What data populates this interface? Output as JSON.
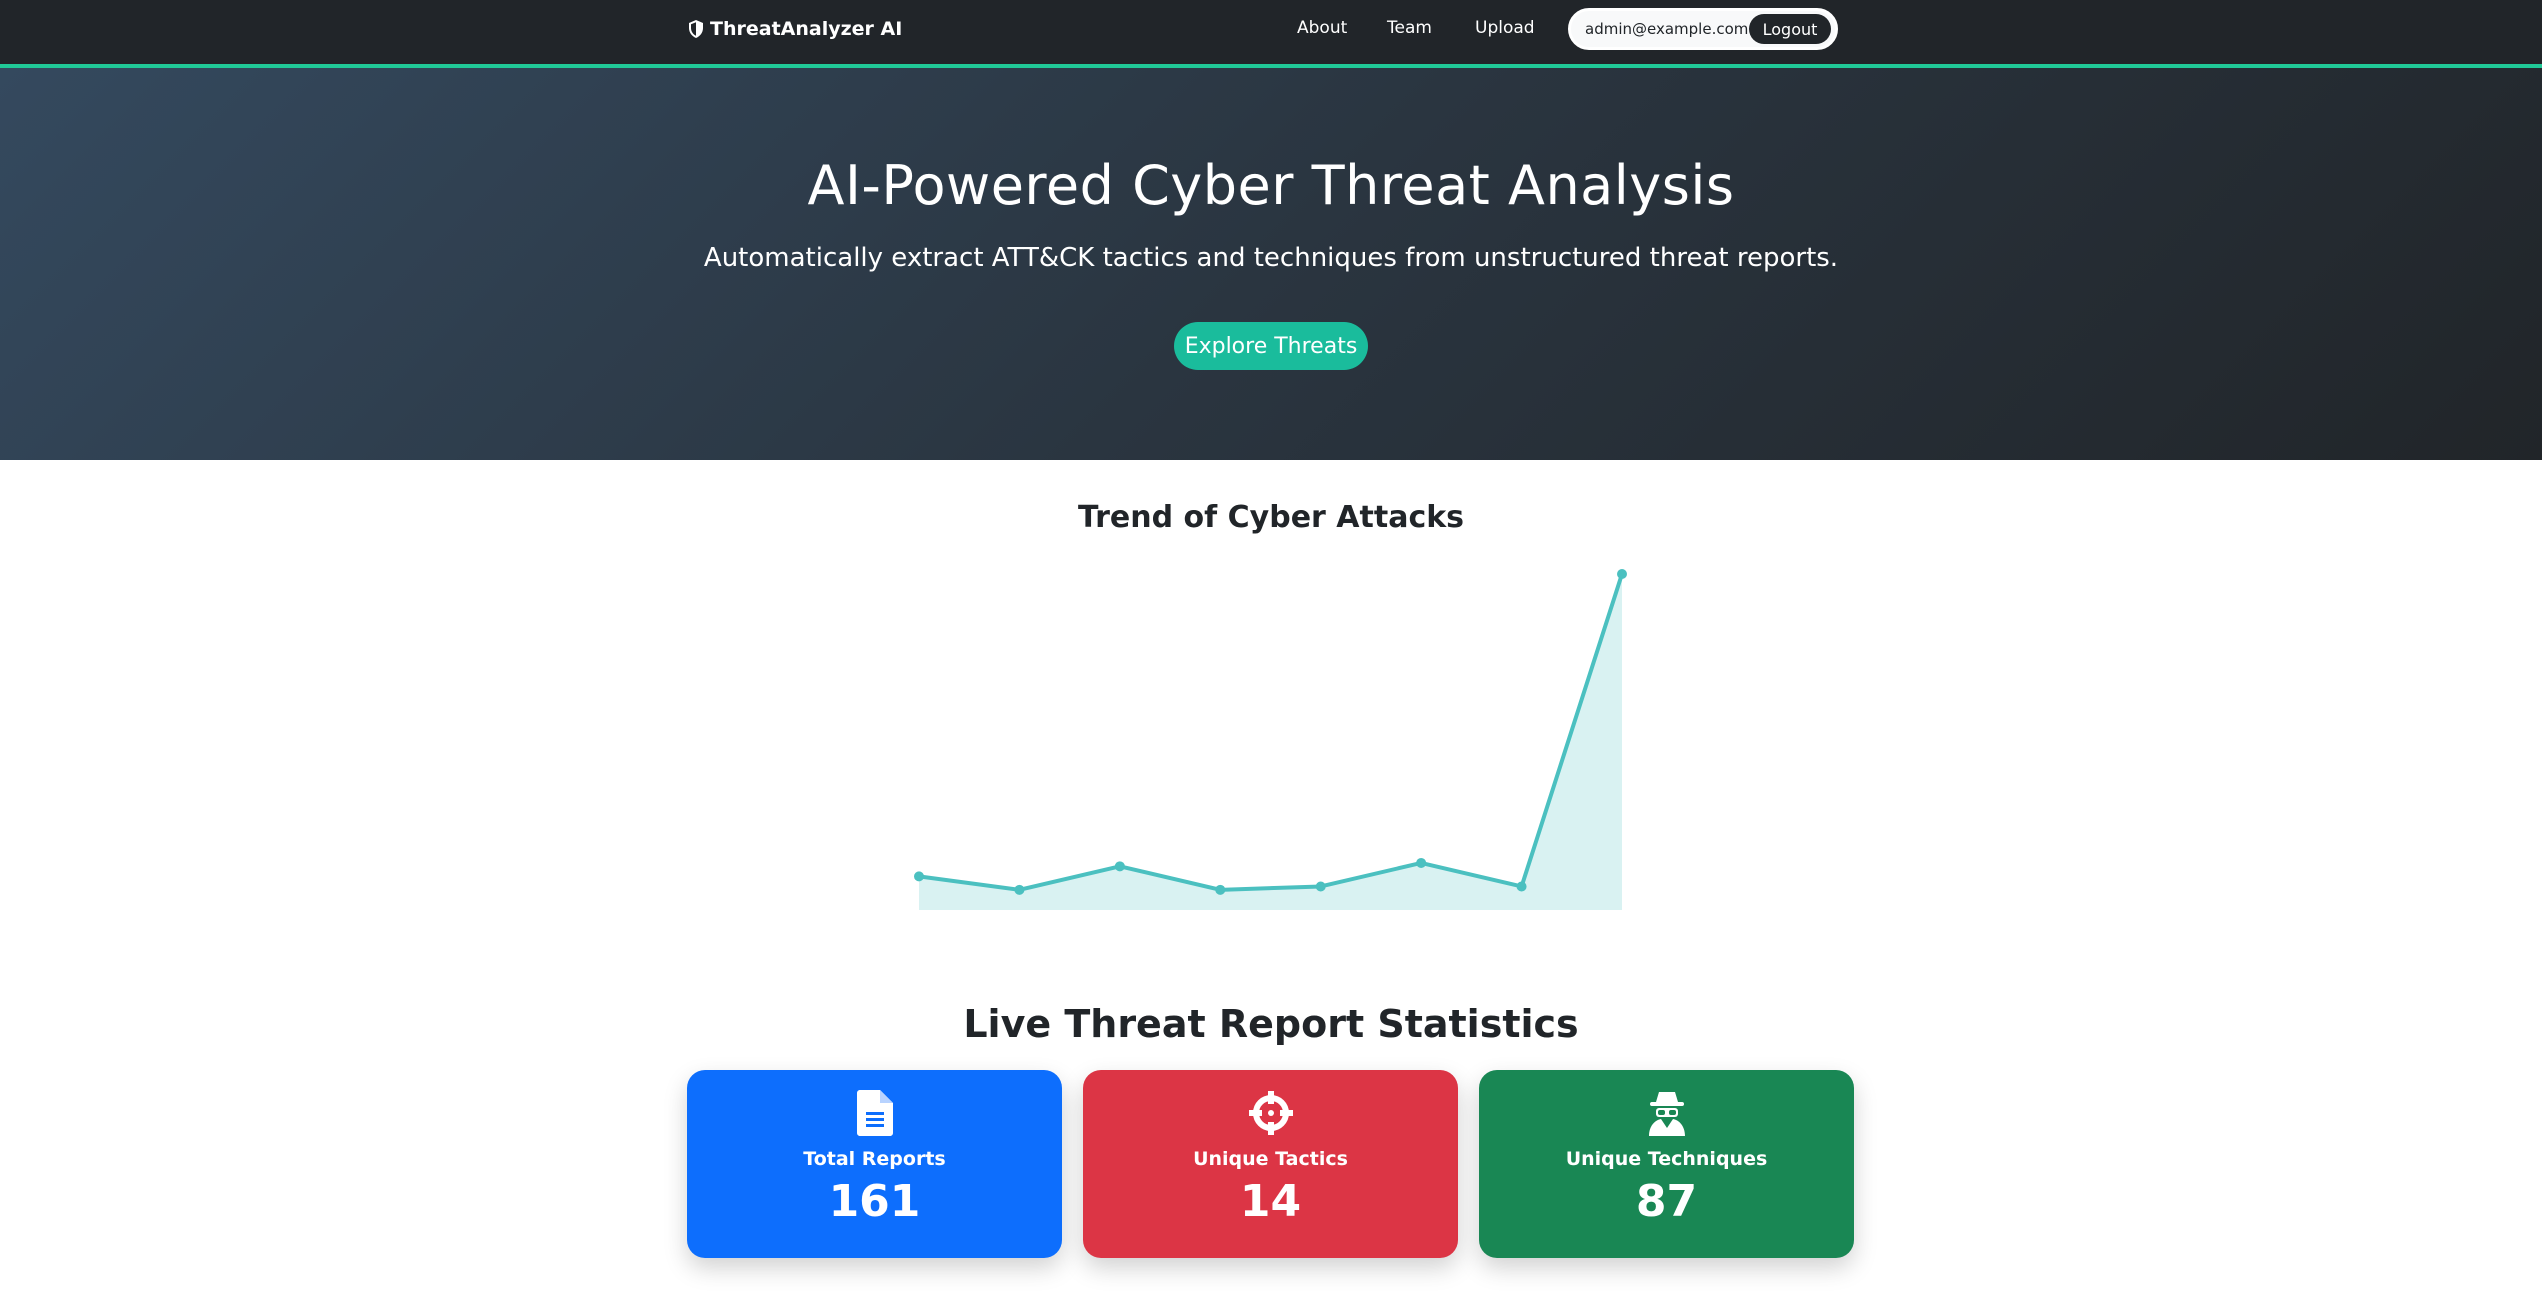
{
  "navbar": {
    "brand": "ThreatAnalyzer AI",
    "brand_icon": "shield-icon",
    "links": [
      "About",
      "Team",
      "Upload"
    ],
    "user_email": "admin@example.com",
    "logout_label": "Logout"
  },
  "hero": {
    "title": "AI-Powered Cyber Threat Analysis",
    "subtitle": "Automatically extract ATT&CK tactics and techniques from unstructured threat reports.",
    "cta_label": "Explore Threats"
  },
  "chart_section": {
    "title": "Trend of Cyber Attacks"
  },
  "chart_data": {
    "type": "area",
    "title": "Trend of Cyber Attacks",
    "x": [
      1,
      2,
      3,
      4,
      5,
      6,
      7,
      8
    ],
    "values": [
      10,
      6,
      13,
      6,
      7,
      14,
      7,
      100
    ],
    "ylim": [
      0,
      100
    ],
    "grid": false,
    "legend": "none",
    "color": "#4bc0c0",
    "fill_color": "#d9f2f2"
  },
  "stats": {
    "title": "Live Threat Report Statistics",
    "cards": [
      {
        "label": "Total Reports",
        "value": "161",
        "icon": "file-icon",
        "color": "#0d6efd"
      },
      {
        "label": "Unique Tactics",
        "value": "14",
        "icon": "crosshairs-icon",
        "color": "#dc3545"
      },
      {
        "label": "Unique Techniques",
        "value": "87",
        "icon": "user-secret-icon",
        "color": "#198754"
      }
    ]
  },
  "colors": {
    "navbar_bg": "#212529",
    "accent": "#20c997",
    "button": "#1abc9c"
  }
}
